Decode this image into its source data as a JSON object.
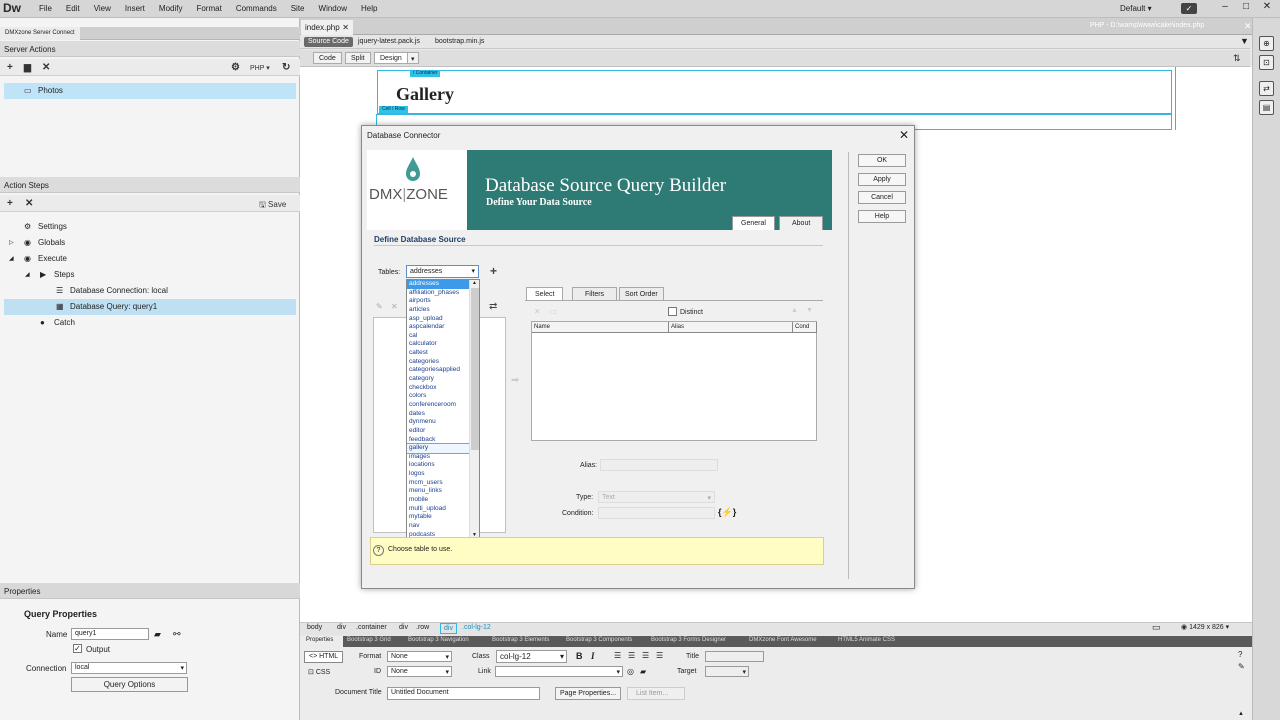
{
  "app": {
    "logo": "Dw",
    "menu": [
      "File",
      "Edit",
      "View",
      "Insert",
      "Modify",
      "Format",
      "Commands",
      "Site",
      "Window",
      "Help"
    ],
    "layout": "Default",
    "winbtns": [
      "–",
      "□",
      "✕"
    ]
  },
  "left": {
    "tab": "DMXzone Server Connect",
    "server_actions": "Server Actions",
    "lang": "PHP",
    "actions": [
      "Photos"
    ],
    "action_steps": "Action Steps",
    "save": "Save",
    "tree": [
      "Settings",
      "Globals",
      "Execute",
      "Steps",
      "Database Connection: local",
      "Database Query: query1",
      "Catch"
    ],
    "properties": "Properties",
    "query_properties": "Query Properties",
    "name_label": "Name",
    "name_value": "query1",
    "output_label": "Output",
    "connection_label": "Connection",
    "connection_value": "local",
    "query_options": "Query Options"
  },
  "doc": {
    "tab": "index.php",
    "path": "PHP - D:\\wamp\\www\\cake\\index.php",
    "source_code": "Source Code",
    "related": [
      "jquery-latest.pack.js",
      "bootstrap.min.js"
    ],
    "views": [
      "Code",
      "Split",
      "Design"
    ],
    "container_tag": "/ Container",
    "row_tag": "Cell  / Row",
    "gallery": "Gallery"
  },
  "dialog": {
    "title": "Database Connector",
    "dmx_left": "DMX",
    "dmx_right": "ZONE",
    "banner_title": "Database Source Query Builder",
    "banner_sub": "Define Your Data Source",
    "tabs": [
      "General",
      "About"
    ],
    "section": "Define Database Source",
    "buttons": [
      "OK",
      "Apply",
      "Cancel",
      "Help"
    ],
    "tables_label": "Tables:",
    "tables_value": "addresses",
    "tables": [
      "addresses",
      "affiliation_phases",
      "airports",
      "articles",
      "asp_upload",
      "aspcalendar",
      "cal",
      "calculator",
      "caltest",
      "categories",
      "categoriesapplied",
      "category",
      "checkbox",
      "colors",
      "conferenceroom",
      "dates",
      "dynmenu",
      "editor",
      "feedback",
      "gallery",
      "images",
      "locations",
      "logos",
      "mcm_users",
      "menu_links",
      "mobile",
      "multi_upload",
      "mytable",
      "nav",
      "podcasts"
    ],
    "sub_tabs": [
      "Select",
      "Filters",
      "Sort Order"
    ],
    "distinct": "Distinct",
    "columns": [
      "Name",
      "Alias",
      "Cond"
    ],
    "alias_label": "Alias:",
    "type_label": "Type:",
    "type_value": "Text",
    "condition_label": "Condition:",
    "tip": "Choose table to use."
  },
  "tags": [
    "body",
    "div",
    ".container",
    "div",
    ".row",
    "div",
    ".col-lg-12"
  ],
  "viewport": "1429 x 826",
  "prop_tabs": [
    "Properties",
    "Bootstrap 3 Grid",
    "Bootstrap 3 Navigation",
    "Bootstrap 3 Elements",
    "Bootstrap 3 Components",
    "Bootstrap 3 Forms Designer",
    "DMXzone Font Awesome",
    "HTML5 Animate CSS"
  ],
  "props": {
    "html": "HTML",
    "css": "CSS",
    "format_label": "Format",
    "format_value": "None",
    "id_label": "ID",
    "id_value": "None",
    "class_label": "Class",
    "class_value": "col-lg-12",
    "link_label": "Link",
    "title_label": "Title",
    "target_label": "Target",
    "doc_title_label": "Document Title",
    "doc_title_value": "Untitled Document",
    "page_props": "Page Properties...",
    "list_item": "List Item..."
  }
}
